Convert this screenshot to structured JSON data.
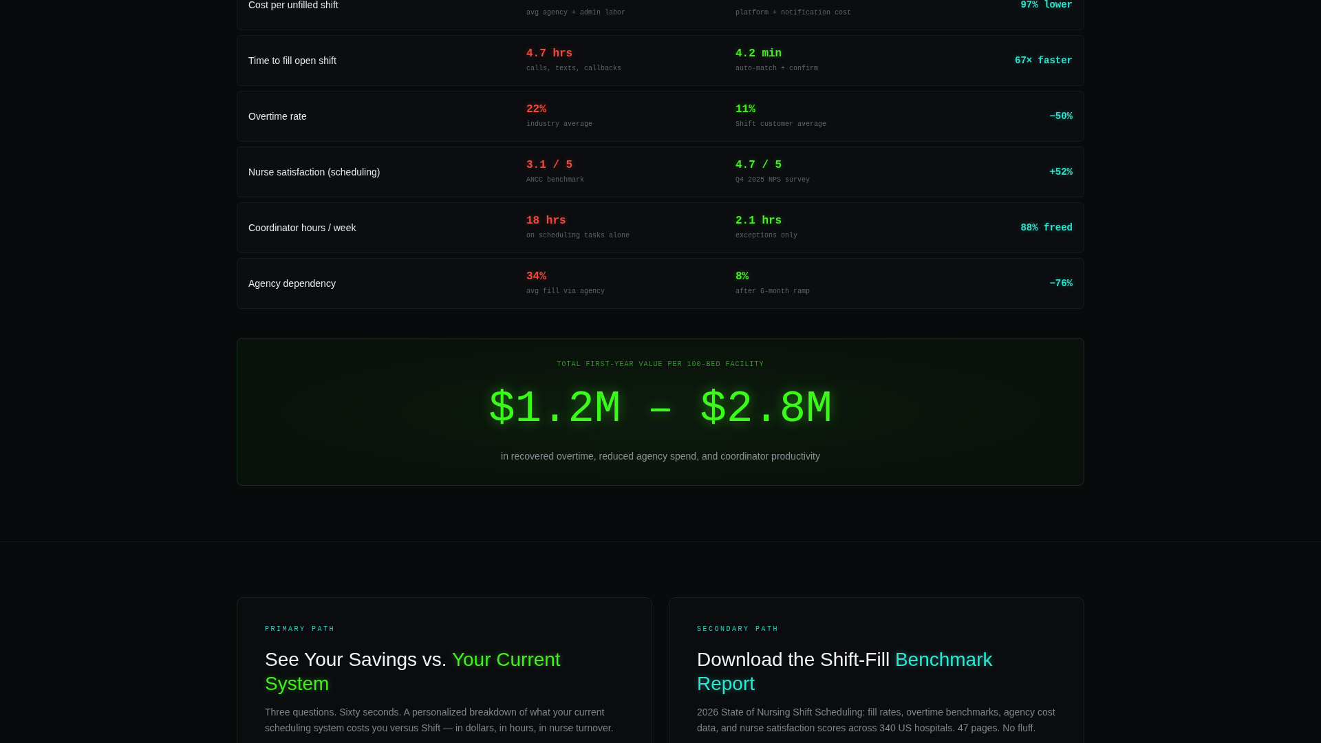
{
  "comparison_rows": [
    {
      "metric": "Cost per unfilled shift",
      "before": {
        "note": "avg agency + admin labor"
      },
      "after": {
        "note": "platform + notification cost"
      },
      "change": "97% lower"
    },
    {
      "metric": "Time to fill open shift",
      "before": {
        "value": "4.7 hrs",
        "note": "calls, texts, callbacks"
      },
      "after": {
        "value": "4.2 min",
        "note": "auto-match + confirm"
      },
      "change": "67× faster"
    },
    {
      "metric": "Overtime rate",
      "before": {
        "value": "22%",
        "note": "industry average"
      },
      "after": {
        "value": "11%",
        "note": "Shift customer average"
      },
      "change": "−50%"
    },
    {
      "metric": "Nurse satisfaction (scheduling)",
      "before": {
        "value": "3.1 / 5",
        "note": "ANCC benchmark"
      },
      "after": {
        "value": "4.7 / 5",
        "note": "Q4 2025 NPS survey"
      },
      "change": "+52%"
    },
    {
      "metric": "Coordinator hours / week",
      "before": {
        "value": "18 hrs",
        "note": "on scheduling tasks alone"
      },
      "after": {
        "value": "2.1 hrs",
        "note": "exceptions only"
      },
      "change": "88% freed"
    },
    {
      "metric": "Agency dependency",
      "before": {
        "value": "34%",
        "note": "avg fill via agency"
      },
      "after": {
        "value": "8%",
        "note": "after 6-month ramp"
      },
      "change": "−76%"
    }
  ],
  "total_value": {
    "label": "TOTAL FIRST-YEAR VALUE PER 100-BED FACILITY",
    "amount": "$1.2M – $2.8M",
    "caption": "in recovered overtime, reduced agency spend, and coordinator productivity"
  },
  "paths": [
    {
      "kind": "primary",
      "eyebrow": "PRIMARY PATH",
      "title": "See Your Savings vs.",
      "title_accent": "Your Current System",
      "description": "Three questions. Sixty seconds. A personalized breakdown of what your current scheduling system costs you versus Shift — in dollars, in hours, in nurse turnover."
    },
    {
      "kind": "secondary",
      "eyebrow": "SECONDARY PATH",
      "title": "Download the Shift-Fill",
      "title_accent": "Benchmark Report",
      "description": "2026 State of Nursing Shift Scheduling: fill rates, overtime benchmarks, agency cost data, and nurse satisfaction scores across 340 US hospitals. 47 pages. No fluff."
    }
  ]
}
